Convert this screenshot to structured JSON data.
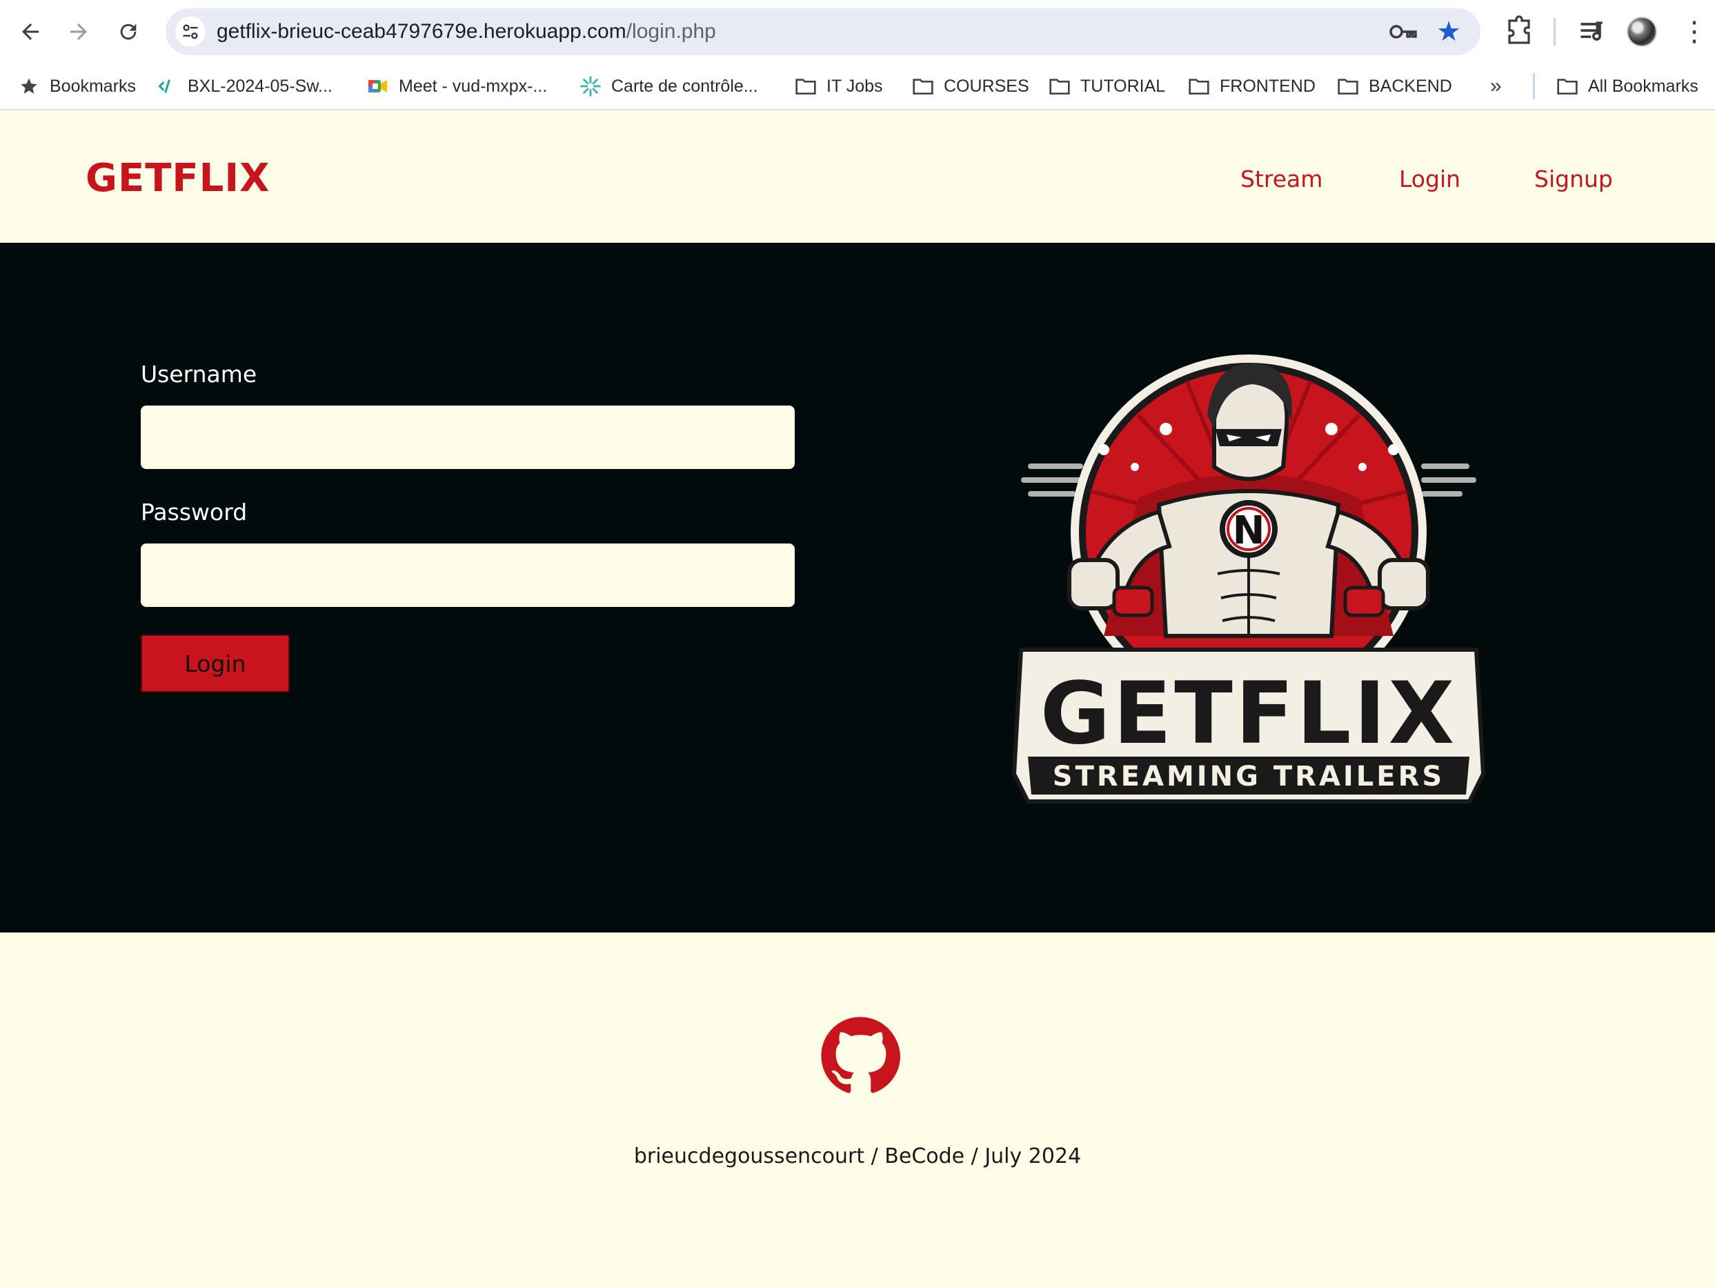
{
  "browser": {
    "url_host": "getflix-brieuc-ceab4797679e.herokuapp.com",
    "url_path": "/login.php",
    "bookmarks": [
      {
        "label": "Bookmarks",
        "icon": "star-icon"
      },
      {
        "label": "BXL-2024-05-Sw...",
        "icon": "code-icon"
      },
      {
        "label": "Meet - vud-mxpx-...",
        "icon": "meet-icon"
      },
      {
        "label": "Carte de contrôle...",
        "icon": "spark-icon"
      },
      {
        "label": "IT Jobs",
        "icon": "folder-icon"
      },
      {
        "label": "COURSES",
        "icon": "folder-icon"
      },
      {
        "label": "TUTORIAL",
        "icon": "folder-icon"
      },
      {
        "label": "FRONTEND",
        "icon": "folder-icon"
      },
      {
        "label": "BACKEND",
        "icon": "folder-icon"
      }
    ],
    "more_bookmarks": "»",
    "all_bookmarks": "All Bookmarks"
  },
  "header": {
    "brand": "GETFLIX",
    "nav": [
      "Stream",
      "Login",
      "Signup"
    ]
  },
  "login_form": {
    "username_label": "Username",
    "username_value": "",
    "password_label": "Password",
    "password_value": "",
    "submit_label": "Login"
  },
  "logo": {
    "title": "GETFLIX",
    "subtitle": "STREAMING TRAILERS",
    "emblem_letter": "N"
  },
  "footer": {
    "credit": "brieucdegoussencourt / BeCode / July 2024"
  },
  "colors": {
    "brand_red": "#c8141c",
    "cream": "#fdfde8",
    "dark": "#020b0b"
  }
}
